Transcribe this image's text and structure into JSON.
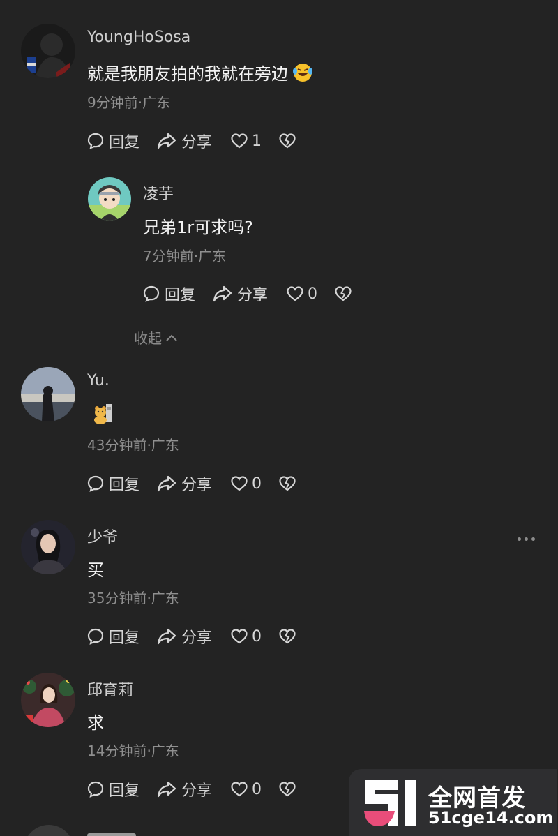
{
  "comments": [
    {
      "username": "YoungHoSosa",
      "text": "就是我朋友拍的我就在旁边",
      "meta": "9分钟前·广东",
      "reply_label": "回复",
      "share_label": "分享",
      "likes": "1"
    },
    {
      "username": "凌芋",
      "text": "兄弟1r可求吗?",
      "meta": "7分钟前·广东",
      "reply_label": "回复",
      "share_label": "分享",
      "likes": "0"
    },
    {
      "username": "Yu.",
      "text": "",
      "meta": "43分钟前·广东",
      "reply_label": "回复",
      "share_label": "分享",
      "likes": "0"
    },
    {
      "username": "少爷",
      "text": "买",
      "meta": "35分钟前·广东",
      "reply_label": "回复",
      "share_label": "分享",
      "likes": "0"
    },
    {
      "username": "邱育莉",
      "text": "求",
      "meta": "14分钟前·广东",
      "reply_label": "回复",
      "share_label": "分享",
      "likes": "0"
    }
  ],
  "collapse_label": "收起",
  "watermark": {
    "title": "全网首发",
    "url": "51cge14.com"
  },
  "icons": {
    "reply": "comment-bubble-icon",
    "share": "share-arrow-icon",
    "like": "heart-icon",
    "dislike": "broken-heart-icon",
    "more": "more-dots-icon",
    "laugh": "laughing-tears-emoji",
    "bear": "bear-sticker-emoji"
  },
  "colors": {
    "background": "#232323",
    "meta": "#8f8f8f",
    "text": "#f2f2f2"
  }
}
